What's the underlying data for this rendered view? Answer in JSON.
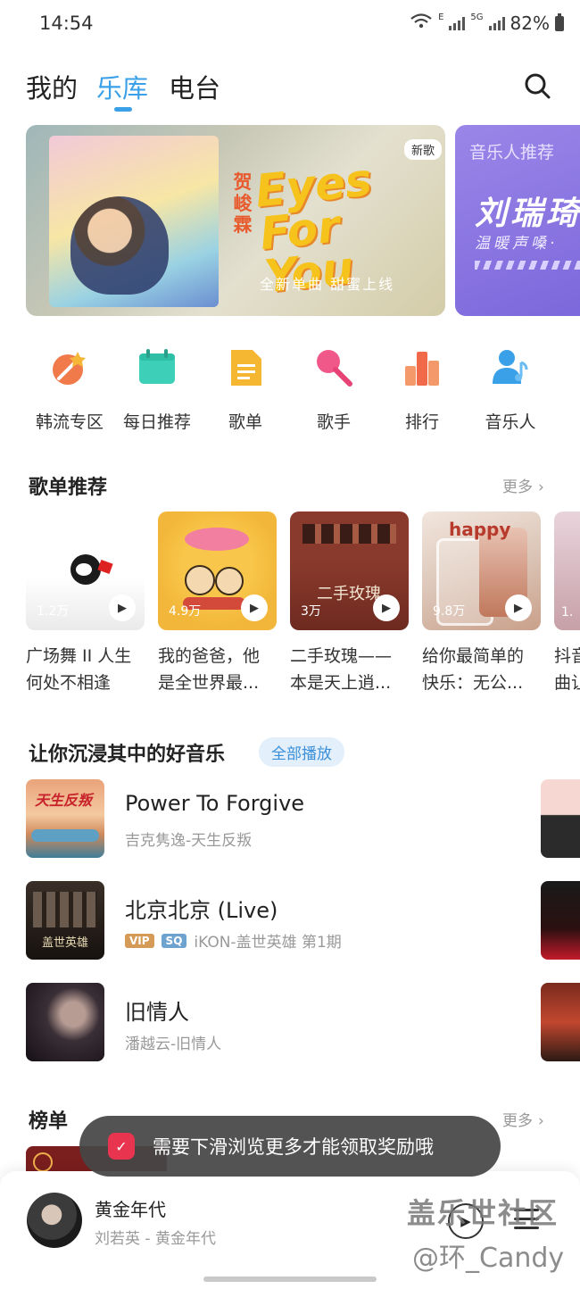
{
  "status_bar": {
    "time": "14:54",
    "network1": "E",
    "network2": "5G",
    "battery": "82%"
  },
  "tabs": [
    {
      "label": "我的",
      "active": false
    },
    {
      "label": "乐库",
      "active": true
    },
    {
      "label": "电台",
      "active": false
    }
  ],
  "banners": [
    {
      "badge": "新歌",
      "artist_vertical": "贺峻霖",
      "headline": "Eyes For You",
      "subtitle": "全新单曲 甜蜜上线"
    },
    {
      "label": "音乐人推荐",
      "headline": "刘瑞琦",
      "subtitle": "温暖声嗓·"
    }
  ],
  "categories": [
    {
      "label": "韩流专区",
      "icon": "korean-zone-icon",
      "color": "#f07a4a"
    },
    {
      "label": "每日推荐",
      "icon": "calendar-icon",
      "color": "#3dcfb8"
    },
    {
      "label": "歌单",
      "icon": "playlist-doc-icon",
      "color": "#f5b731"
    },
    {
      "label": "歌手",
      "icon": "microphone-icon",
      "color": "#f0588a"
    },
    {
      "label": "排行",
      "icon": "ranking-icon",
      "color": "#f06a4a"
    },
    {
      "label": "音乐人",
      "icon": "musician-icon",
      "color": "#3aa0e8"
    }
  ],
  "playlist_section": {
    "title": "歌单推荐",
    "more": "更多",
    "items": [
      {
        "count": "1.2万",
        "line1": "广场舞 II 人生",
        "line2": "何处不相逢"
      },
      {
        "count": "4.9万",
        "line1": "我的爸爸，他",
        "line2": "是全世界最..."
      },
      {
        "count": "3万",
        "line1": "二手玫瑰——",
        "line2": "本是天上逍..."
      },
      {
        "count": "9.8万",
        "line1": "给你最简单的",
        "line2": "快乐：无公..."
      },
      {
        "count": "1.",
        "line1": "抖音",
        "line2": "曲让"
      }
    ]
  },
  "immersive_section": {
    "title": "让你沉浸其中的好音乐",
    "play_all": "全部播放",
    "songs": [
      {
        "title": "Power To Forgive",
        "subtitle": "吉克隽逸-天生反叛",
        "vip": "",
        "sq": ""
      },
      {
        "title": "北京北京 (Live)",
        "subtitle": "iKON-盖世英雄 第1期",
        "vip": "VIP",
        "sq": "SQ"
      },
      {
        "title": "旧情人",
        "subtitle": "潘越云-旧情人",
        "vip": "",
        "sq": ""
      }
    ]
  },
  "charts_section": {
    "title": "榜单",
    "more": "更多"
  },
  "toast": {
    "text": "需要下滑浏览更多才能领取奖励哦"
  },
  "player": {
    "title": "黄金年代",
    "subtitle": "刘若英 - 黄金年代"
  },
  "watermark": {
    "line1": "盖乐世社区",
    "line2": "@环_Candy"
  }
}
